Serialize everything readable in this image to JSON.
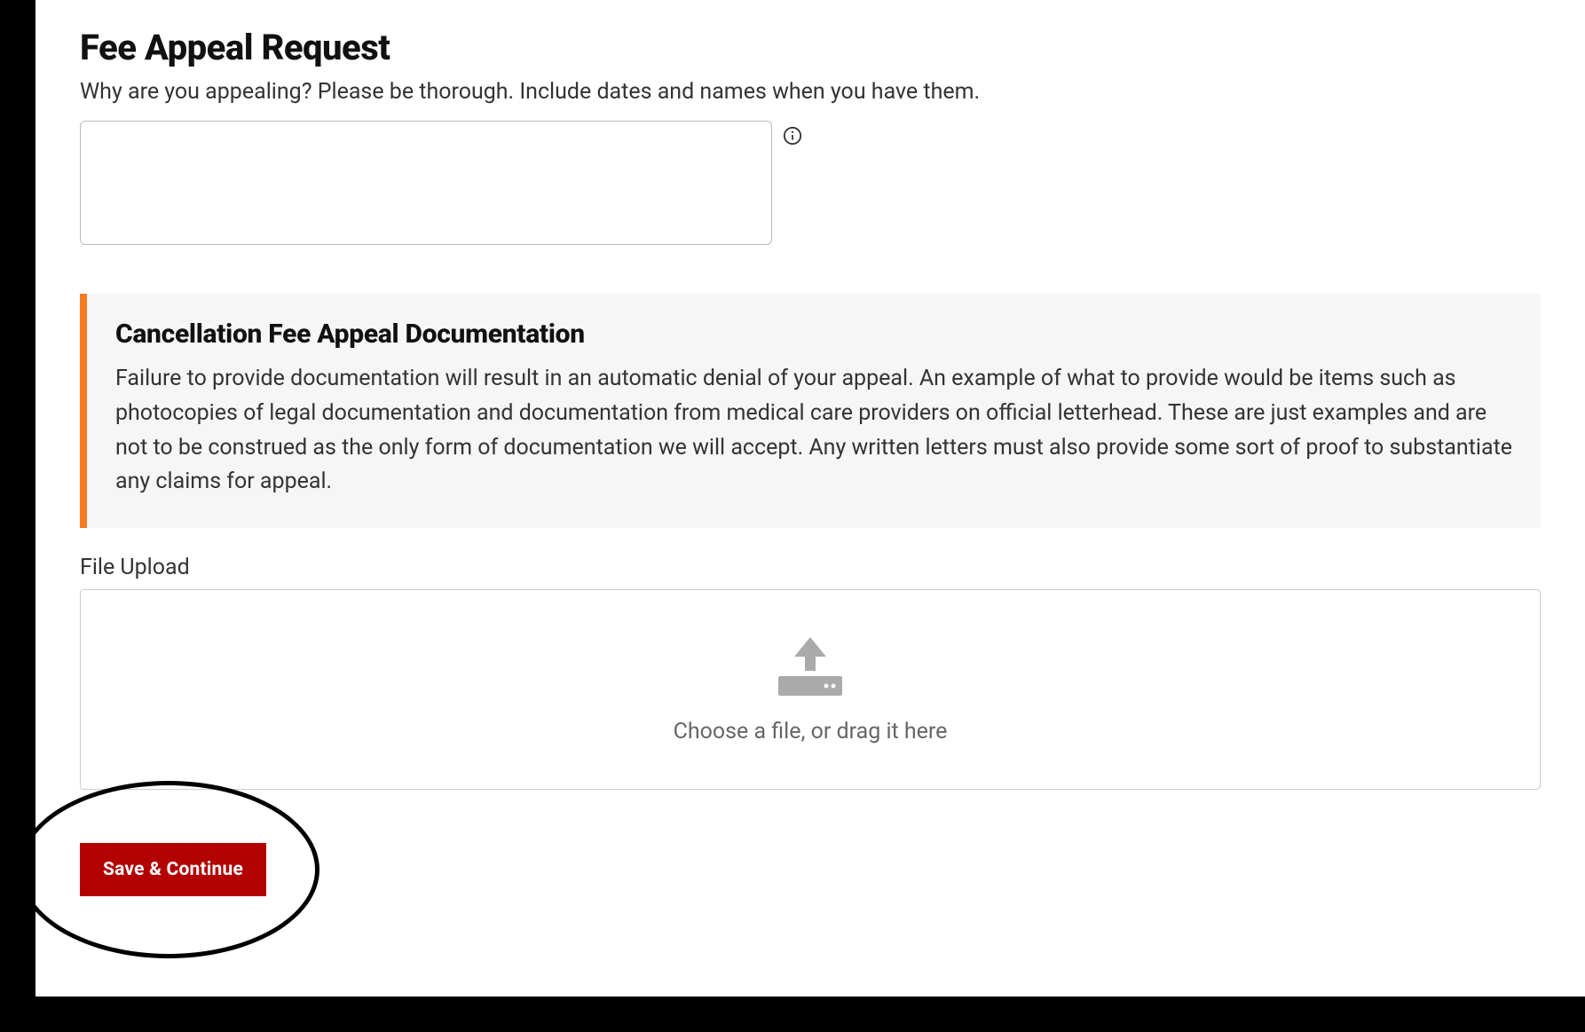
{
  "header": {
    "title": "Fee Appeal Request",
    "subtitle": "Why are you appealing? Please be thorough. Include dates and names when you have them."
  },
  "textarea": {
    "value": "",
    "placeholder": ""
  },
  "callout": {
    "title": "Cancellation Fee Appeal Documentation",
    "body": "Failure to provide documentation will result in an automatic denial of your appeal. An example of what to provide would be items such as photocopies of legal documentation and documentation from medical care providers on official letterhead. These are just examples and are not to be construed as the only form of documentation we will accept. Any written letters must also provide some sort of proof to substantiate any claims for appeal."
  },
  "upload": {
    "label": "File Upload",
    "hint": "Choose a file, or drag it here"
  },
  "buttons": {
    "save_continue": "Save & Continue"
  },
  "icons": {
    "info": "info-icon",
    "upload": "upload-icon"
  },
  "colors": {
    "accent_orange": "#f57c1f",
    "button_red": "#b30000",
    "bg_gray": "#f6f6f6"
  }
}
